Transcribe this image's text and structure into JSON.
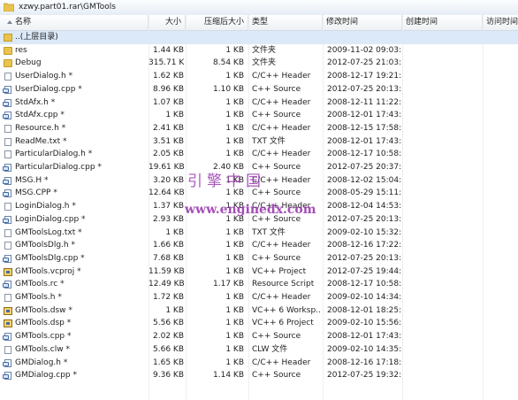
{
  "address_bar": {
    "path": "xzwy.part01.rar\\GMTools"
  },
  "columns": {
    "name": "名称",
    "size": "大小",
    "compressed": "压缩后大小",
    "type": "类型",
    "modified": "修改时间",
    "created": "创建时间",
    "accessed": "访问时间"
  },
  "parent_row": {
    "label": "..(上层目录)"
  },
  "files": [
    {
      "name": "res",
      "size": "1.44 KB",
      "compressed": "1 KB",
      "type": "文件夹",
      "modified": "2009-11-02 09:03:..",
      "icon": "folder-icon"
    },
    {
      "name": "Debug",
      "size": "315.71 KB",
      "compressed": "8.54 KB",
      "type": "文件夹",
      "modified": "2012-07-25 21:03:..",
      "icon": "folder-icon"
    },
    {
      "name": "UserDialog.h *",
      "size": "1.62 KB",
      "compressed": "1 KB",
      "type": "C/C++ Header",
      "modified": "2008-12-17 19:21:..",
      "icon": "document-icon"
    },
    {
      "name": "UserDialog.cpp *",
      "size": "8.96 KB",
      "compressed": "1.10 KB",
      "type": "C++ Source",
      "modified": "2012-07-25 20:13:..",
      "icon": "source-file-icon"
    },
    {
      "name": "StdAfx.h *",
      "size": "1.07 KB",
      "compressed": "1 KB",
      "type": "C/C++ Header",
      "modified": "2008-12-11 11:22:..",
      "icon": "source-file-icon"
    },
    {
      "name": "StdAfx.cpp *",
      "size": "1 KB",
      "compressed": "1 KB",
      "type": "C++ Source",
      "modified": "2008-12-01 17:43:..",
      "icon": "source-file-icon"
    },
    {
      "name": "Resource.h *",
      "size": "2.41 KB",
      "compressed": "1 KB",
      "type": "C/C++ Header",
      "modified": "2008-12-15 17:58:..",
      "icon": "document-icon"
    },
    {
      "name": "ReadMe.txt *",
      "size": "3.51 KB",
      "compressed": "1 KB",
      "type": "TXT 文件",
      "modified": "2008-12-01 17:43:..",
      "icon": "document-icon"
    },
    {
      "name": "ParticularDialog.h *",
      "size": "2.05 KB",
      "compressed": "1 KB",
      "type": "C/C++ Header",
      "modified": "2008-12-17 10:58:..",
      "icon": "document-icon"
    },
    {
      "name": "ParticularDialog.cpp *",
      "size": "19.61 KB",
      "compressed": "2.40 KB",
      "type": "C++ Source",
      "modified": "2012-07-25 20:37:..",
      "icon": "source-file-icon"
    },
    {
      "name": "MSG.H *",
      "size": "3.20 KB",
      "compressed": "1 KB",
      "type": "C/C++ Header",
      "modified": "2008-12-02 15:04:..",
      "icon": "source-file-icon"
    },
    {
      "name": "MSG.CPP *",
      "size": "12.64 KB",
      "compressed": "1 KB",
      "type": "C++ Source",
      "modified": "2008-05-29 15:11:..",
      "icon": "source-file-icon"
    },
    {
      "name": "LoginDialog.h *",
      "size": "1.37 KB",
      "compressed": "1 KB",
      "type": "C/C++ Header",
      "modified": "2008-12-04 14:53:..",
      "icon": "document-icon"
    },
    {
      "name": "LoginDialog.cpp *",
      "size": "2.93 KB",
      "compressed": "1 KB",
      "type": "C++ Source",
      "modified": "2012-07-25 20:13:..",
      "icon": "source-file-icon"
    },
    {
      "name": "GMToolsLog.txt *",
      "size": "1 KB",
      "compressed": "1 KB",
      "type": "TXT 文件",
      "modified": "2009-02-10 15:32:..",
      "icon": "document-icon"
    },
    {
      "name": "GMToolsDlg.h *",
      "size": "1.66 KB",
      "compressed": "1 KB",
      "type": "C/C++ Header",
      "modified": "2008-12-16 17:22:..",
      "icon": "document-icon"
    },
    {
      "name": "GMToolsDlg.cpp *",
      "size": "7.68 KB",
      "compressed": "1 KB",
      "type": "C++ Source",
      "modified": "2012-07-25 20:13:..",
      "icon": "source-file-icon"
    },
    {
      "name": "GMTools.vcproj *",
      "size": "11.59 KB",
      "compressed": "1 KB",
      "type": "VC++ Project",
      "modified": "2012-07-25 19:44:..",
      "icon": "project-icon"
    },
    {
      "name": "GMTools.rc *",
      "size": "12.49 KB",
      "compressed": "1.17 KB",
      "type": "Resource Script",
      "modified": "2008-12-17 10:58:..",
      "icon": "source-file-icon"
    },
    {
      "name": "GMTools.h *",
      "size": "1.72 KB",
      "compressed": "1 KB",
      "type": "C/C++ Header",
      "modified": "2009-02-10 14:34:..",
      "icon": "document-icon"
    },
    {
      "name": "GMTools.dsw *",
      "size": "1 KB",
      "compressed": "1 KB",
      "type": "VC++ 6 Worksp...",
      "modified": "2008-12-01 18:25:..",
      "icon": "project-icon"
    },
    {
      "name": "GMTools.dsp *",
      "size": "5.56 KB",
      "compressed": "1 KB",
      "type": "VC++ 6 Project",
      "modified": "2009-02-10 15:56:..",
      "icon": "project-icon"
    },
    {
      "name": "GMTools.cpp *",
      "size": "2.02 KB",
      "compressed": "1 KB",
      "type": "C++ Source",
      "modified": "2008-12-01 17:43:..",
      "icon": "source-file-icon"
    },
    {
      "name": "GMTools.clw *",
      "size": "5.66 KB",
      "compressed": "1 KB",
      "type": "CLW 文件",
      "modified": "2009-02-10 14:35:..",
      "icon": "document-icon"
    },
    {
      "name": "GMDialog.h *",
      "size": "1.65 KB",
      "compressed": "1 KB",
      "type": "C/C++ Header",
      "modified": "2008-12-16 17:18:..",
      "icon": "source-file-icon"
    },
    {
      "name": "GMDialog.cpp *",
      "size": "9.36 KB",
      "compressed": "1.14 KB",
      "type": "C++ Source",
      "modified": "2012-07-25 19:32:..",
      "icon": "source-file-icon"
    }
  ],
  "watermark": {
    "line1": "引擎中国",
    "line2": "www.enginedx.com"
  },
  "colors": {
    "selected_row": "#dce9f8",
    "watermark": "#9b3bb0",
    "folder": "#e8c34f"
  }
}
